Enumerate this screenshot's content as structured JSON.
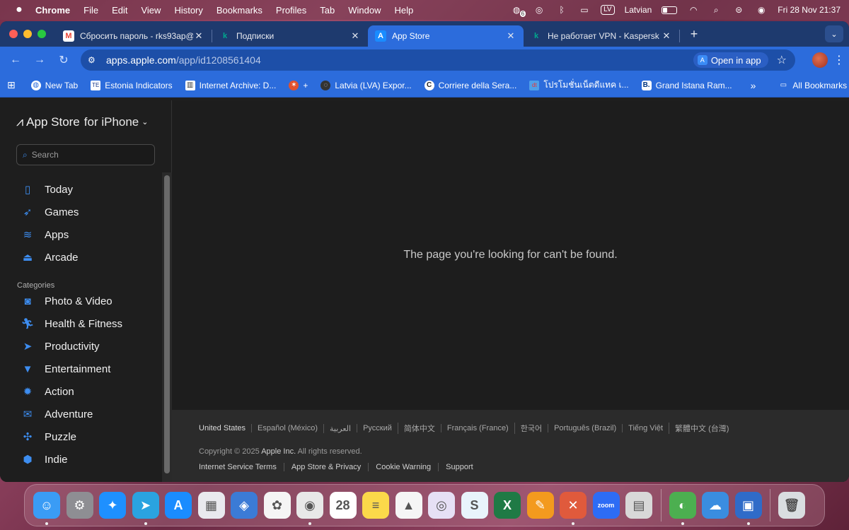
{
  "menubar": {
    "app": "Chrome",
    "items": [
      "File",
      "Edit",
      "View",
      "History",
      "Bookmarks",
      "Profiles",
      "Tab",
      "Window",
      "Help"
    ],
    "notification_count": "6",
    "input_source_badge": "LV",
    "input_source": "Latvian",
    "datetime": "Fri 28 Nov  21:37"
  },
  "tabs": [
    {
      "title": "Сбросить пароль - rks93ap@",
      "favicon": "gmail-icon",
      "favicon_char": "M",
      "favicon_color": "#ea4335",
      "active": false
    },
    {
      "title": "Подписки",
      "favicon": "kaspersky-icon",
      "favicon_char": "k",
      "favicon_color": "#00a88e",
      "active": false
    },
    {
      "title": "App Store",
      "favicon": "app-store-icon",
      "favicon_char": "A",
      "favicon_color": "#1a8cff",
      "active": true
    },
    {
      "title": "Не работает VPN - Kaspersk",
      "favicon": "kaspersky-icon",
      "favicon_char": "k",
      "favicon_color": "#00a88e",
      "active": false
    }
  ],
  "toolbar": {
    "url_host": "apps.apple.com",
    "url_path": "/app/id1208561404",
    "open_in_app": "Open in app"
  },
  "bookmarks": [
    {
      "label": "New Tab",
      "icon": "globe-icon"
    },
    {
      "label": "Estonia Indicators",
      "icon": "te-icon"
    },
    {
      "label": "Internet Archive: D...",
      "icon": "archive-icon"
    },
    {
      "label": "+",
      "icon": "plus-bookmark-icon"
    },
    {
      "label": "Latvia (LVA) Expor...",
      "icon": "oec-icon"
    },
    {
      "label": "Corriere della Sera...",
      "icon": "corriere-icon"
    },
    {
      "label": "โปรโมชั่นเน็ตดีแทค เ...",
      "icon": "dtac-icon"
    },
    {
      "label": "Grand Istana Ram...",
      "icon": "booking-icon"
    }
  ],
  "all_bookmarks": "All Bookmarks",
  "sidebar": {
    "store_name": "App Store",
    "store_for": "for iPhone",
    "search_placeholder": "Search",
    "nav": [
      {
        "label": "Today",
        "icon": "today-icon"
      },
      {
        "label": "Games",
        "icon": "rocket-icon"
      },
      {
        "label": "Apps",
        "icon": "layers-icon"
      },
      {
        "label": "Arcade",
        "icon": "joystick-icon"
      }
    ],
    "categories_header": "Categories",
    "categories": [
      {
        "label": "Photo & Video",
        "icon": "camera-icon"
      },
      {
        "label": "Health & Fitness",
        "icon": "runner-icon"
      },
      {
        "label": "Productivity",
        "icon": "paper-plane-icon"
      },
      {
        "label": "Entertainment",
        "icon": "popcorn-icon"
      },
      {
        "label": "Action",
        "icon": "burst-icon"
      },
      {
        "label": "Adventure",
        "icon": "ticket-icon"
      },
      {
        "label": "Puzzle",
        "icon": "puzzle-icon"
      },
      {
        "label": "Indie",
        "icon": "indie-icon"
      }
    ]
  },
  "main": {
    "not_found": "The page you're looking for can't be found."
  },
  "footer": {
    "languages": [
      "United States",
      "Español (México)",
      "العربية",
      "Русский",
      "简体中文",
      "Français (France)",
      "한국어",
      "Português (Brazil)",
      "Tiếng Việt",
      "繁體中文 (台灣)"
    ],
    "copyright_prefix": "Copyright © 2025",
    "copyright_brand": "Apple Inc.",
    "copyright_suffix": "All rights reserved.",
    "links": [
      "Internet Service Terms",
      "App Store & Privacy",
      "Cookie Warning",
      "Support"
    ]
  },
  "dock": [
    {
      "name": "finder",
      "color": "#3a9cf5",
      "glyph": "☺",
      "running": true
    },
    {
      "name": "system-settings",
      "color": "#8e8e93",
      "glyph": "⚙",
      "running": false
    },
    {
      "name": "safari",
      "color": "#1e90ff",
      "glyph": "✦",
      "running": false
    },
    {
      "name": "telegram",
      "color": "#2aa3e0",
      "glyph": "➤",
      "running": true
    },
    {
      "name": "app-store",
      "color": "#1a8cff",
      "glyph": "A",
      "running": false
    },
    {
      "name": "launchpad",
      "color": "#e9e9ee",
      "glyph": "▦",
      "running": false
    },
    {
      "name": "pixelmator",
      "color": "#3b7bd6",
      "glyph": "◈",
      "running": false
    },
    {
      "name": "photos",
      "color": "#f5f5f5",
      "glyph": "✿",
      "running": false
    },
    {
      "name": "chrome",
      "color": "#e8e8e8",
      "glyph": "◉",
      "running": true
    },
    {
      "name": "calendar",
      "color": "#ffffff",
      "glyph": "28",
      "running": false
    },
    {
      "name": "notes",
      "color": "#fbd94a",
      "glyph": "≡",
      "running": false
    },
    {
      "name": "vlc",
      "color": "#f5f5f5",
      "glyph": "▲",
      "running": false
    },
    {
      "name": "tor-browser",
      "color": "#e6e0f5",
      "glyph": "◎",
      "running": false
    },
    {
      "name": "skype",
      "color": "#e8f4fc",
      "glyph": "S",
      "running": false
    },
    {
      "name": "excel",
      "color": "#1f7a45",
      "glyph": "X",
      "running": false
    },
    {
      "name": "pages",
      "color": "#f39a1e",
      "glyph": "✎",
      "running": false
    },
    {
      "name": "remote-desktop",
      "color": "#e05a3c",
      "glyph": "✕",
      "running": true
    },
    {
      "name": "zoom",
      "color": "#2d6cf5",
      "glyph": "zoom",
      "running": false
    },
    {
      "name": "calculator",
      "color": "#d8d8d8",
      "glyph": "▤",
      "running": false
    },
    {
      "name": "network-app",
      "color": "#4caf50",
      "glyph": "◐",
      "running": true
    },
    {
      "name": "weather",
      "color": "#3a8de0",
      "glyph": "☁",
      "running": false
    },
    {
      "name": "preview-scanner",
      "color": "#2f6bc8",
      "glyph": "▣",
      "running": true
    },
    {
      "name": "trash",
      "color": "#d9dde0",
      "glyph": "🗑",
      "running": false
    }
  ]
}
